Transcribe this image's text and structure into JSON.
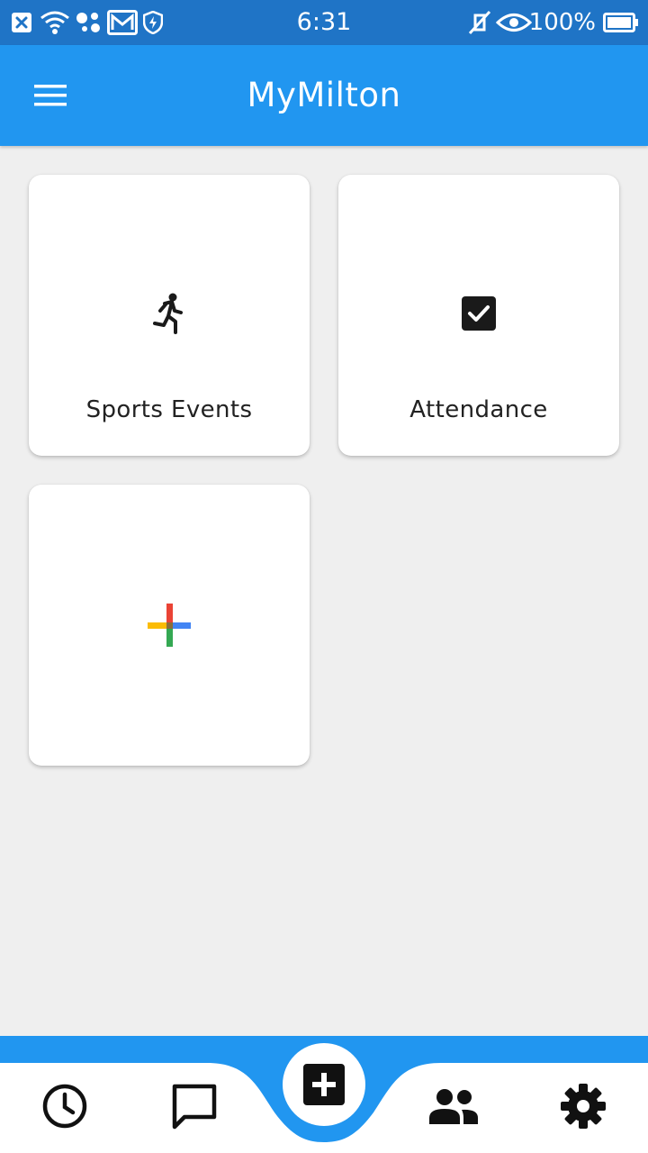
{
  "status_bar": {
    "time": "6:31",
    "battery": "100%",
    "icons_left": [
      "close-notification-icon",
      "wifi-icon",
      "dots-icon",
      "gmail-icon",
      "shield-icon"
    ],
    "icons_right": [
      "vibrate-off-icon",
      "eye-icon",
      "battery-icon"
    ]
  },
  "app_bar": {
    "title": "MyMilton",
    "menu_icon": "hamburger-menu-icon"
  },
  "tiles": [
    {
      "label": "Sports Events",
      "icon": "running-person-icon"
    },
    {
      "label": "Attendance",
      "icon": "checkbox-checked-icon"
    },
    {
      "label": "",
      "icon": "add-colored-plus-icon"
    }
  ],
  "bottom_nav": {
    "items": [
      {
        "icon": "clock-icon"
      },
      {
        "icon": "chat-bubble-icon"
      },
      {
        "icon": "add-box-icon"
      },
      {
        "icon": "people-icon"
      },
      {
        "icon": "settings-gear-icon"
      }
    ]
  },
  "colors": {
    "status_bar": "#1f74c6",
    "app_bar": "#2196f0",
    "background": "#efefef",
    "card": "#ffffff",
    "plus_red": "#ea4335",
    "plus_blue": "#4285f4",
    "plus_green": "#34a853",
    "plus_yellow": "#fbbc05"
  }
}
